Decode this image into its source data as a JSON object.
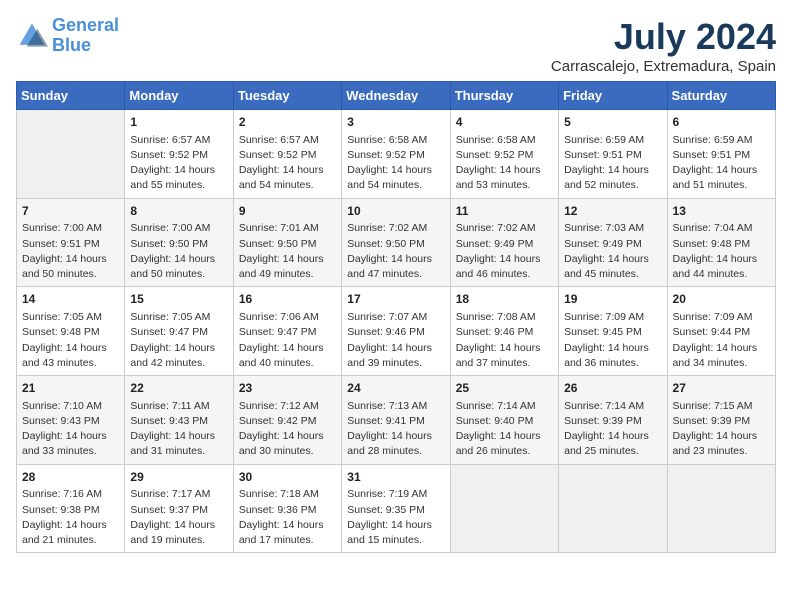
{
  "logo": {
    "line1": "General",
    "line2": "Blue"
  },
  "title": "July 2024",
  "location": "Carrascalejo, Extremadura, Spain",
  "weekdays": [
    "Sunday",
    "Monday",
    "Tuesday",
    "Wednesday",
    "Thursday",
    "Friday",
    "Saturday"
  ],
  "weeks": [
    [
      {
        "day": "",
        "info": ""
      },
      {
        "day": "1",
        "info": "Sunrise: 6:57 AM\nSunset: 9:52 PM\nDaylight: 14 hours\nand 55 minutes."
      },
      {
        "day": "2",
        "info": "Sunrise: 6:57 AM\nSunset: 9:52 PM\nDaylight: 14 hours\nand 54 minutes."
      },
      {
        "day": "3",
        "info": "Sunrise: 6:58 AM\nSunset: 9:52 PM\nDaylight: 14 hours\nand 54 minutes."
      },
      {
        "day": "4",
        "info": "Sunrise: 6:58 AM\nSunset: 9:52 PM\nDaylight: 14 hours\nand 53 minutes."
      },
      {
        "day": "5",
        "info": "Sunrise: 6:59 AM\nSunset: 9:51 PM\nDaylight: 14 hours\nand 52 minutes."
      },
      {
        "day": "6",
        "info": "Sunrise: 6:59 AM\nSunset: 9:51 PM\nDaylight: 14 hours\nand 51 minutes."
      }
    ],
    [
      {
        "day": "7",
        "info": "Sunrise: 7:00 AM\nSunset: 9:51 PM\nDaylight: 14 hours\nand 50 minutes."
      },
      {
        "day": "8",
        "info": "Sunrise: 7:00 AM\nSunset: 9:50 PM\nDaylight: 14 hours\nand 50 minutes."
      },
      {
        "day": "9",
        "info": "Sunrise: 7:01 AM\nSunset: 9:50 PM\nDaylight: 14 hours\nand 49 minutes."
      },
      {
        "day": "10",
        "info": "Sunrise: 7:02 AM\nSunset: 9:50 PM\nDaylight: 14 hours\nand 47 minutes."
      },
      {
        "day": "11",
        "info": "Sunrise: 7:02 AM\nSunset: 9:49 PM\nDaylight: 14 hours\nand 46 minutes."
      },
      {
        "day": "12",
        "info": "Sunrise: 7:03 AM\nSunset: 9:49 PM\nDaylight: 14 hours\nand 45 minutes."
      },
      {
        "day": "13",
        "info": "Sunrise: 7:04 AM\nSunset: 9:48 PM\nDaylight: 14 hours\nand 44 minutes."
      }
    ],
    [
      {
        "day": "14",
        "info": "Sunrise: 7:05 AM\nSunset: 9:48 PM\nDaylight: 14 hours\nand 43 minutes."
      },
      {
        "day": "15",
        "info": "Sunrise: 7:05 AM\nSunset: 9:47 PM\nDaylight: 14 hours\nand 42 minutes."
      },
      {
        "day": "16",
        "info": "Sunrise: 7:06 AM\nSunset: 9:47 PM\nDaylight: 14 hours\nand 40 minutes."
      },
      {
        "day": "17",
        "info": "Sunrise: 7:07 AM\nSunset: 9:46 PM\nDaylight: 14 hours\nand 39 minutes."
      },
      {
        "day": "18",
        "info": "Sunrise: 7:08 AM\nSunset: 9:46 PM\nDaylight: 14 hours\nand 37 minutes."
      },
      {
        "day": "19",
        "info": "Sunrise: 7:09 AM\nSunset: 9:45 PM\nDaylight: 14 hours\nand 36 minutes."
      },
      {
        "day": "20",
        "info": "Sunrise: 7:09 AM\nSunset: 9:44 PM\nDaylight: 14 hours\nand 34 minutes."
      }
    ],
    [
      {
        "day": "21",
        "info": "Sunrise: 7:10 AM\nSunset: 9:43 PM\nDaylight: 14 hours\nand 33 minutes."
      },
      {
        "day": "22",
        "info": "Sunrise: 7:11 AM\nSunset: 9:43 PM\nDaylight: 14 hours\nand 31 minutes."
      },
      {
        "day": "23",
        "info": "Sunrise: 7:12 AM\nSunset: 9:42 PM\nDaylight: 14 hours\nand 30 minutes."
      },
      {
        "day": "24",
        "info": "Sunrise: 7:13 AM\nSunset: 9:41 PM\nDaylight: 14 hours\nand 28 minutes."
      },
      {
        "day": "25",
        "info": "Sunrise: 7:14 AM\nSunset: 9:40 PM\nDaylight: 14 hours\nand 26 minutes."
      },
      {
        "day": "26",
        "info": "Sunrise: 7:14 AM\nSunset: 9:39 PM\nDaylight: 14 hours\nand 25 minutes."
      },
      {
        "day": "27",
        "info": "Sunrise: 7:15 AM\nSunset: 9:39 PM\nDaylight: 14 hours\nand 23 minutes."
      }
    ],
    [
      {
        "day": "28",
        "info": "Sunrise: 7:16 AM\nSunset: 9:38 PM\nDaylight: 14 hours\nand 21 minutes."
      },
      {
        "day": "29",
        "info": "Sunrise: 7:17 AM\nSunset: 9:37 PM\nDaylight: 14 hours\nand 19 minutes."
      },
      {
        "day": "30",
        "info": "Sunrise: 7:18 AM\nSunset: 9:36 PM\nDaylight: 14 hours\nand 17 minutes."
      },
      {
        "day": "31",
        "info": "Sunrise: 7:19 AM\nSunset: 9:35 PM\nDaylight: 14 hours\nand 15 minutes."
      },
      {
        "day": "",
        "info": ""
      },
      {
        "day": "",
        "info": ""
      },
      {
        "day": "",
        "info": ""
      }
    ]
  ]
}
